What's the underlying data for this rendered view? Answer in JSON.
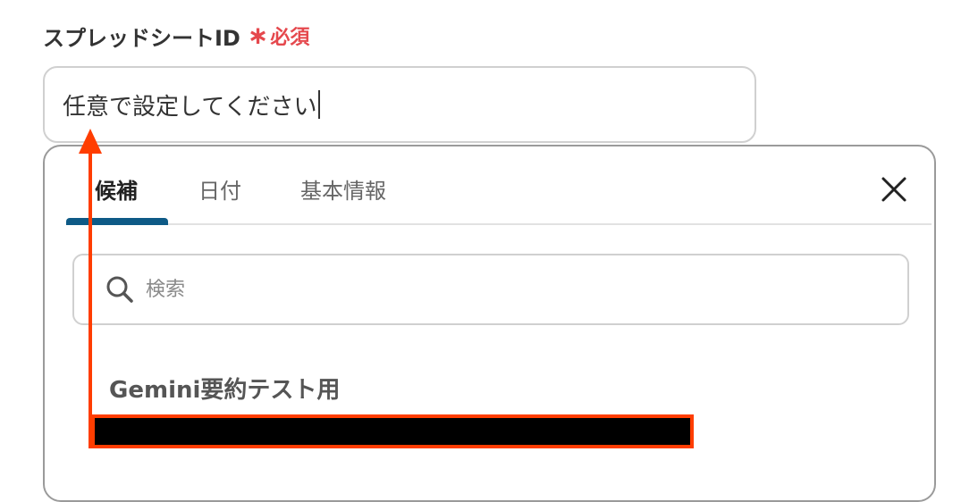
{
  "field": {
    "label": "スプレッドシートID",
    "required_asterisk": "∗",
    "required_text": "必須",
    "input_value": "任意で設定してください"
  },
  "popup": {
    "tabs": [
      {
        "label": "候補",
        "active": true
      },
      {
        "label": "日付",
        "active": false
      },
      {
        "label": "基本情報",
        "active": false
      }
    ],
    "close_icon": "close-icon",
    "search": {
      "placeholder": "検索",
      "icon": "search-icon"
    },
    "items": [
      {
        "title": "Gemini要約テスト用",
        "subtitle_redacted": true
      }
    ]
  },
  "colors": {
    "required": "#e5484d",
    "tab_indicator": "#0e5a86",
    "annotation": "#ff3d00",
    "redaction": "#000000"
  }
}
